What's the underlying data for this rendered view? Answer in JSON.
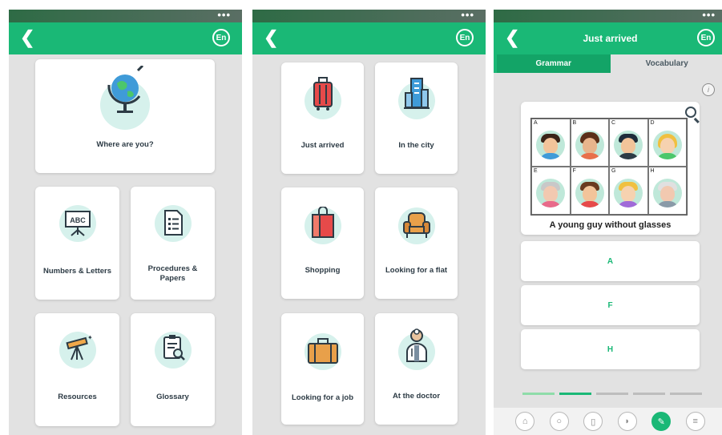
{
  "screens": [
    {
      "status_dots": "•••",
      "title": "",
      "lang_label": "En",
      "cards": [
        {
          "label": "Where are you?",
          "icon": "globe-icon"
        },
        {
          "label": "Numbers & Letters",
          "icon": "abc-board-icon"
        },
        {
          "label": "Procedures & Papers",
          "icon": "document-icon"
        },
        {
          "label": "Resources",
          "icon": "telescope-icon"
        },
        {
          "label": "Glossary",
          "icon": "clipboard-search-icon"
        }
      ]
    },
    {
      "status_dots": "•••",
      "title": "",
      "lang_label": "En",
      "cards": [
        {
          "label": "Just arrived",
          "icon": "suitcase-icon"
        },
        {
          "label": "In the city",
          "icon": "building-icon"
        },
        {
          "label": "Shopping",
          "icon": "shopping-bag-icon"
        },
        {
          "label": "Looking for a flat",
          "icon": "armchair-icon"
        },
        {
          "label": "Looking for a job",
          "icon": "briefcase-icon"
        },
        {
          "label": "At the doctor",
          "icon": "doctor-icon"
        }
      ]
    },
    {
      "status_dots": "•••",
      "title": "Just arrived",
      "lang_label": "En",
      "tabs": [
        "Grammar",
        "Vocabulary"
      ],
      "active_tab": "Vocabulary",
      "info_label": "i",
      "grid_letters": [
        "A",
        "B",
        "C",
        "D",
        "E",
        "F",
        "G",
        "H"
      ],
      "caption": "A young guy without glasses",
      "answers": [
        "A",
        "F",
        "H"
      ],
      "progress": {
        "total": 5,
        "completed": 1,
        "current": 2
      },
      "bottom_nav": [
        {
          "icon": "home-icon",
          "glyph": "⌂"
        },
        {
          "icon": "chat-icon",
          "glyph": "○"
        },
        {
          "icon": "book-icon",
          "glyph": "▯"
        },
        {
          "icon": "audio-icon",
          "glyph": "◗"
        },
        {
          "icon": "pencil-icon",
          "glyph": "✎"
        },
        {
          "icon": "notes-icon",
          "glyph": "≡"
        }
      ],
      "colors": {
        "primary": "#1ab876",
        "tab_active": "#13a467",
        "background": "#e2e2e2",
        "icon_circle": "#d6f1ec"
      }
    }
  ]
}
